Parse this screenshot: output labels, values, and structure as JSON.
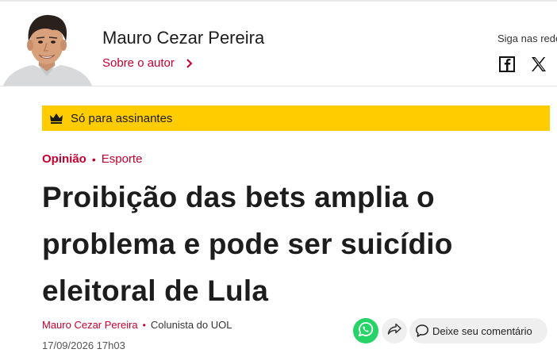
{
  "author_header": {
    "name": "Mauro Cezar Pereira",
    "about_link": "Sobre o autor",
    "follow_label": "Siga nas redes",
    "social_icons": [
      "facebook-icon",
      "x-icon"
    ]
  },
  "subscriber_banner": {
    "label": "Só para assinantes",
    "icon": "crown-icon"
  },
  "article": {
    "category": "Opinião",
    "separator": "•",
    "section": "Esporte",
    "headline": "Proibição das bets amplia o problema e pode ser suicídio eleitoral de Lula",
    "byline": {
      "author": "Mauro Cezar Pereira",
      "separator": "•",
      "role": "Colunista do UOL"
    },
    "timestamp": "17/09/2026 17h03"
  },
  "actions": {
    "comment_label": "Deixe seu comentário",
    "icons": [
      "whatsapp-icon",
      "share-icon",
      "comment-icon"
    ]
  },
  "colors": {
    "accent": "#c3002f",
    "banner": "#ffcc00",
    "whatsapp": "#25d366"
  }
}
